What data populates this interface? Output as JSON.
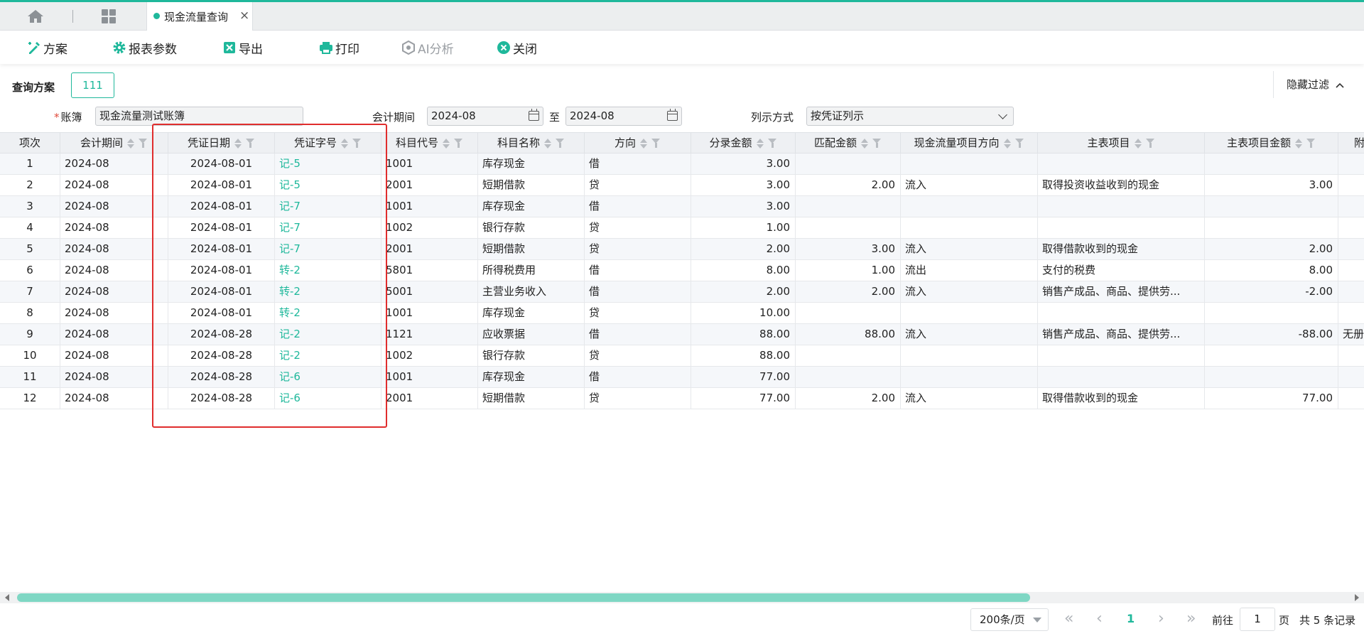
{
  "tabbar": {
    "active_tab": "现金流量查询",
    "close": "×"
  },
  "toolbar": {
    "plan": "方案",
    "params": "报表参数",
    "export": "导出",
    "print": "打印",
    "ai": "AI分析",
    "close": "关闭"
  },
  "filters": {
    "scheme_label": "查询方案",
    "scheme_value": "111",
    "hide_filter": "隐藏过滤",
    "ledger_label": "账簿",
    "ledger_required": "*",
    "ledger_value": "现金流量测试账簿",
    "period_label": "会计期间",
    "period_from": "2024-08",
    "period_to_label": "至",
    "period_to": "2024-08",
    "list_mode_label": "列示方式",
    "list_mode_value": "按凭证列示"
  },
  "table": {
    "columns": [
      "项次",
      "会计期间",
      "凭证日期",
      "凭证字号",
      "科目代号",
      "科目名称",
      "方向",
      "分录金额",
      "匹配金额",
      "现金流量项目方向",
      "主表项目",
      "主表项目金额",
      "附"
    ],
    "rows": [
      [
        "1",
        "2024-08",
        "2024-08-01",
        "记-5",
        "1001",
        "库存现金",
        "借",
        "3.00",
        "",
        "",
        "",
        "",
        ""
      ],
      [
        "2",
        "2024-08",
        "2024-08-01",
        "记-5",
        "2001",
        "短期借款",
        "贷",
        "3.00",
        "2.00",
        "流入",
        "取得投资收益收到的现金",
        "3.00",
        ""
      ],
      [
        "3",
        "2024-08",
        "2024-08-01",
        "记-7",
        "1001",
        "库存现金",
        "借",
        "3.00",
        "",
        "",
        "",
        "",
        ""
      ],
      [
        "4",
        "2024-08",
        "2024-08-01",
        "记-7",
        "1002",
        "银行存款",
        "贷",
        "1.00",
        "",
        "",
        "",
        "",
        ""
      ],
      [
        "5",
        "2024-08",
        "2024-08-01",
        "记-7",
        "2001",
        "短期借款",
        "贷",
        "2.00",
        "3.00",
        "流入",
        "取得借款收到的现金",
        "2.00",
        ""
      ],
      [
        "6",
        "2024-08",
        "2024-08-01",
        "转-2",
        "5801",
        "所得税费用",
        "借",
        "8.00",
        "1.00",
        "流出",
        "支付的税费",
        "8.00",
        ""
      ],
      [
        "7",
        "2024-08",
        "2024-08-01",
        "转-2",
        "5001",
        "主营业务收入",
        "借",
        "2.00",
        "2.00",
        "流入",
        "销售产成品、商品、提供劳...",
        "-2.00",
        ""
      ],
      [
        "8",
        "2024-08",
        "2024-08-01",
        "转-2",
        "1001",
        "库存现金",
        "贷",
        "10.00",
        "",
        "",
        "",
        "",
        ""
      ],
      [
        "9",
        "2024-08",
        "2024-08-28",
        "记-2",
        "1121",
        "应收票据",
        "借",
        "88.00",
        "88.00",
        "流入",
        "销售产成品、商品、提供劳...",
        "-88.00",
        "无册"
      ],
      [
        "10",
        "2024-08",
        "2024-08-28",
        "记-2",
        "1002",
        "银行存款",
        "贷",
        "88.00",
        "",
        "",
        "",
        "",
        ""
      ],
      [
        "11",
        "2024-08",
        "2024-08-28",
        "记-6",
        "1001",
        "库存现金",
        "借",
        "77.00",
        "",
        "",
        "",
        "",
        ""
      ],
      [
        "12",
        "2024-08",
        "2024-08-28",
        "记-6",
        "2001",
        "短期借款",
        "贷",
        "77.00",
        "2.00",
        "流入",
        "取得借款收到的现金",
        "77.00",
        ""
      ]
    ]
  },
  "pager": {
    "page_size": "200条/页",
    "current_page": "1",
    "goto_label": "前往",
    "goto_value": "1",
    "page_unit": "页",
    "total": "共 5 条记录"
  },
  "colors": {
    "accent": "#1fb89b",
    "highlight": "#e02d2d"
  },
  "icons": [
    "home-icon",
    "apps-grid-icon",
    "plan-icon",
    "gear-icon",
    "excel-icon",
    "printer-icon",
    "ai-icon",
    "close-circle-icon",
    "calendar-icon",
    "chevron-down-icon",
    "sort-icon",
    "filter-icon"
  ]
}
